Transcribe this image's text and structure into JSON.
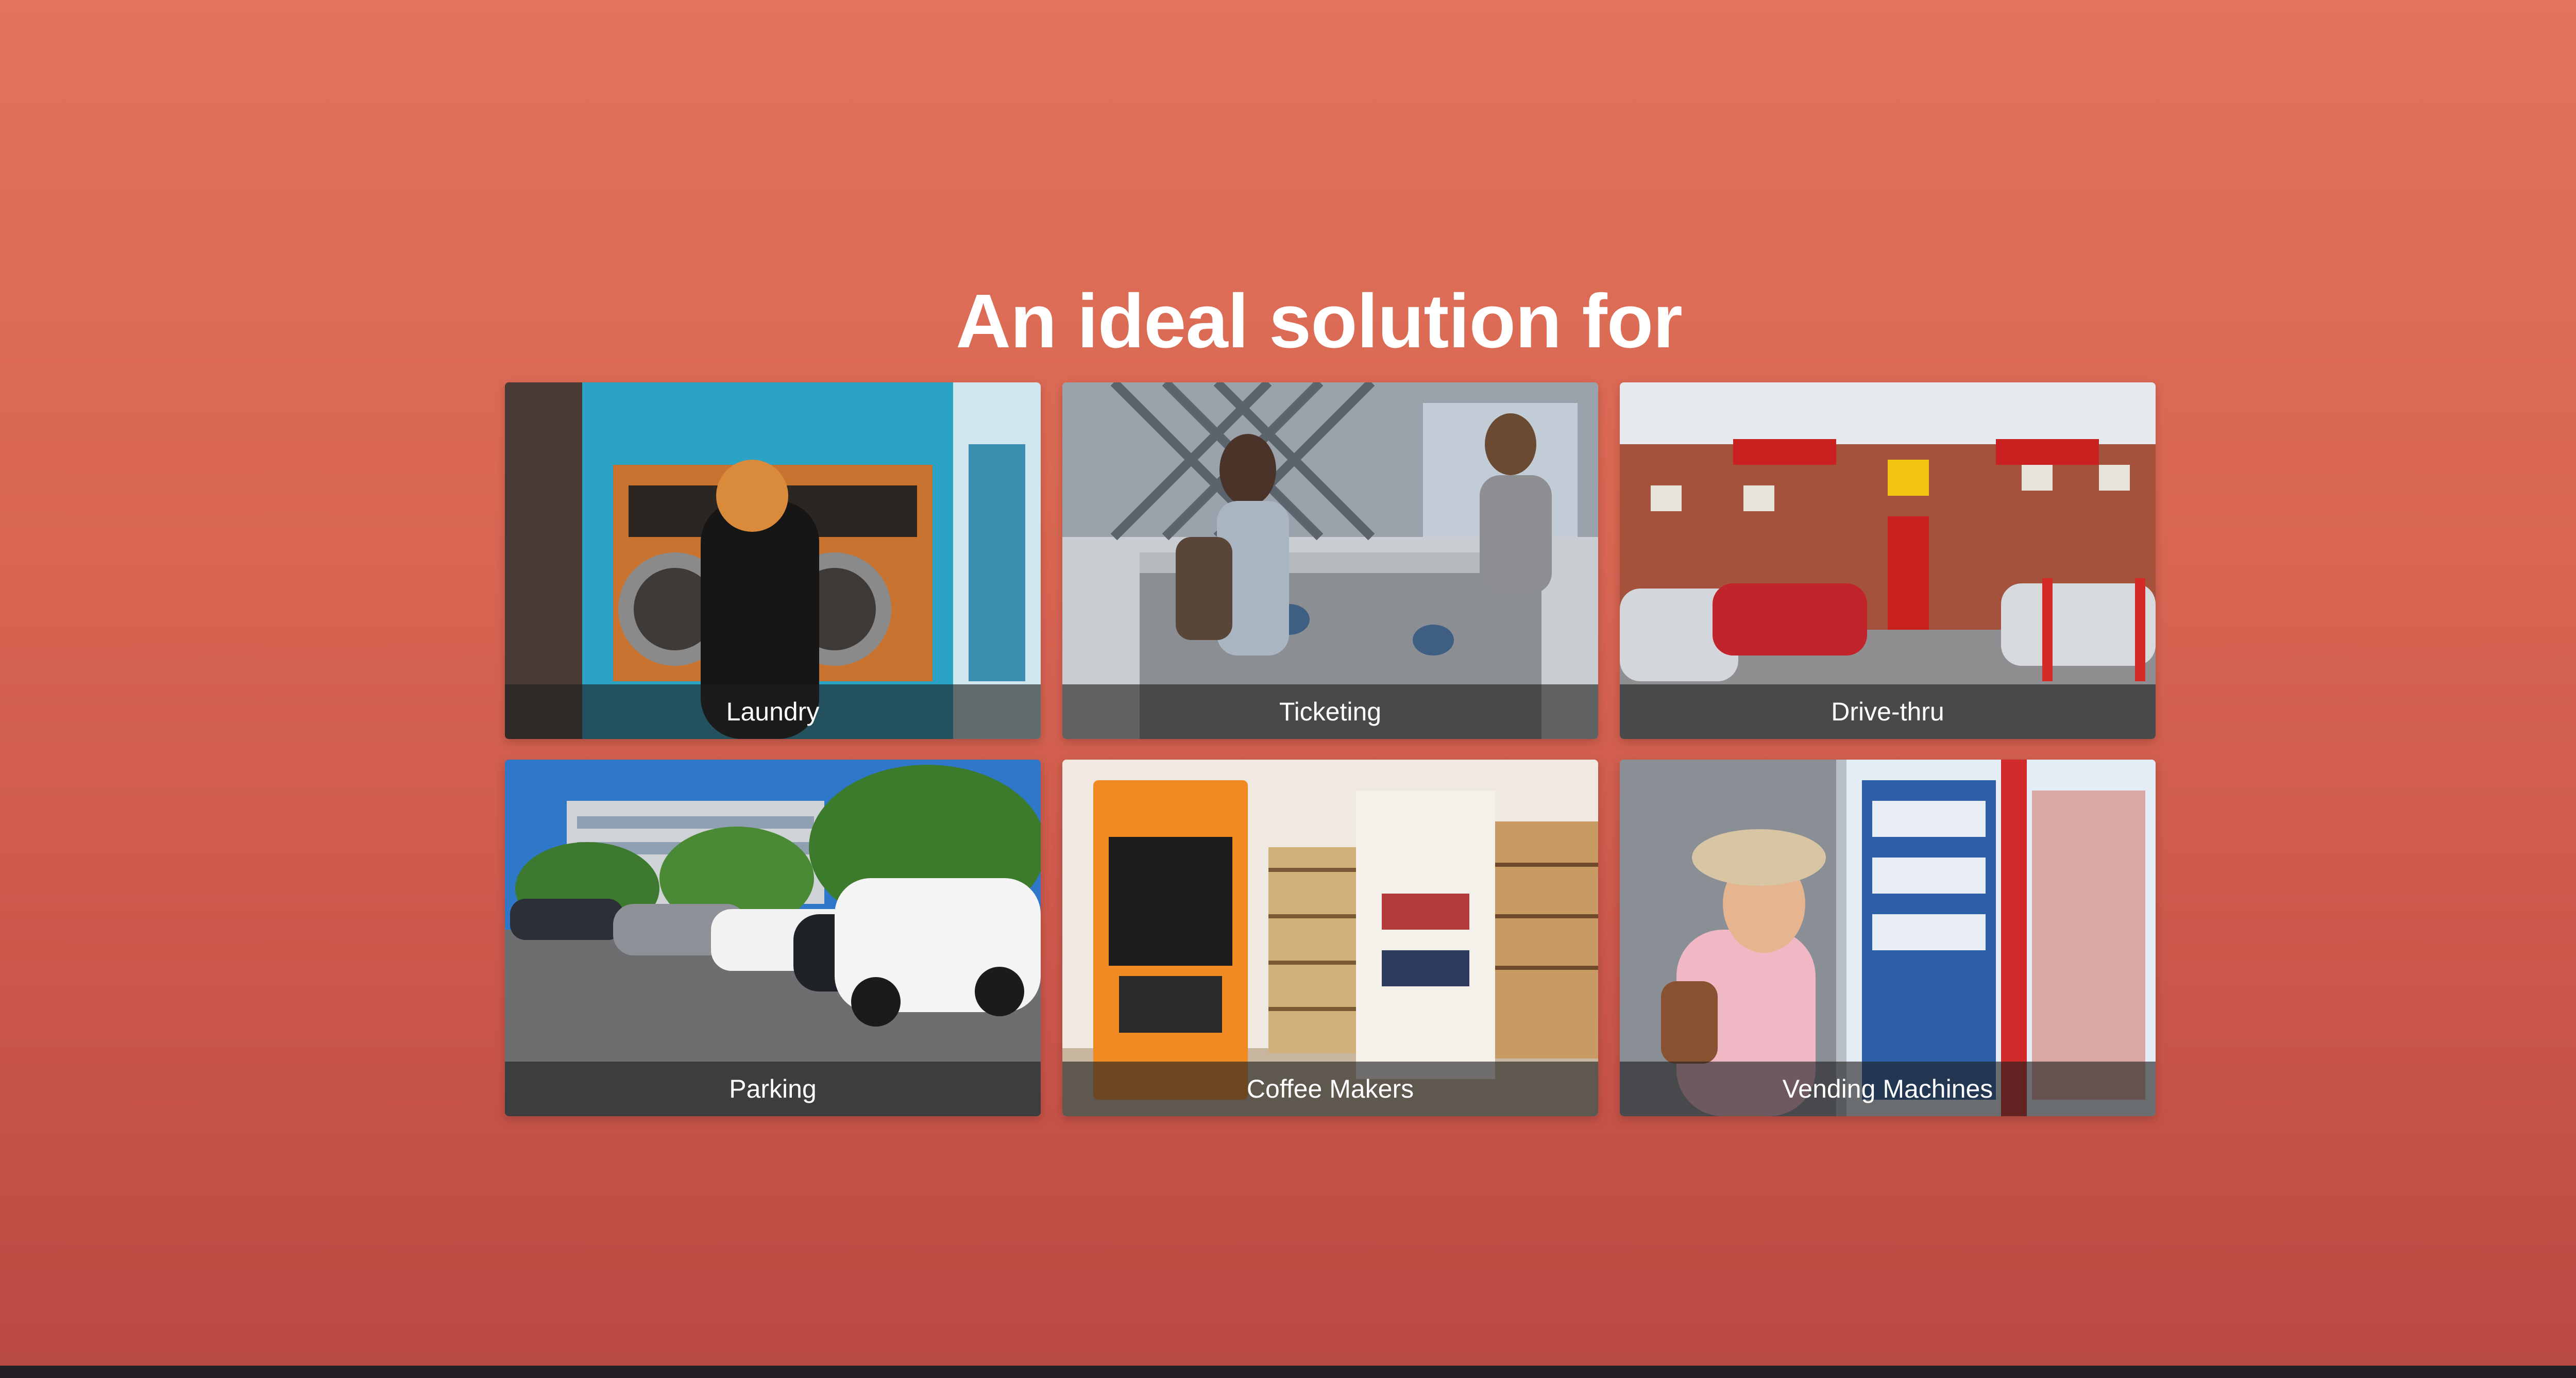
{
  "heading": "An ideal solution for",
  "tiles": [
    {
      "label": "Laundry",
      "icon": "laundry-photo"
    },
    {
      "label": "Ticketing",
      "icon": "ticketing-photo"
    },
    {
      "label": "Drive-thru",
      "icon": "drive-thru-photo"
    },
    {
      "label": "Parking",
      "icon": "parking-photo"
    },
    {
      "label": "Coffee Makers",
      "icon": "coffee-makers-photo"
    },
    {
      "label": "Vending Machines",
      "icon": "vending-machines-photo"
    }
  ],
  "colors": {
    "background_top": "#e2735c",
    "background_bottom": "#b84942",
    "footer": "#231f24",
    "label_overlay": "rgba(30,30,30,0.62)",
    "text": "#ffffff"
  }
}
